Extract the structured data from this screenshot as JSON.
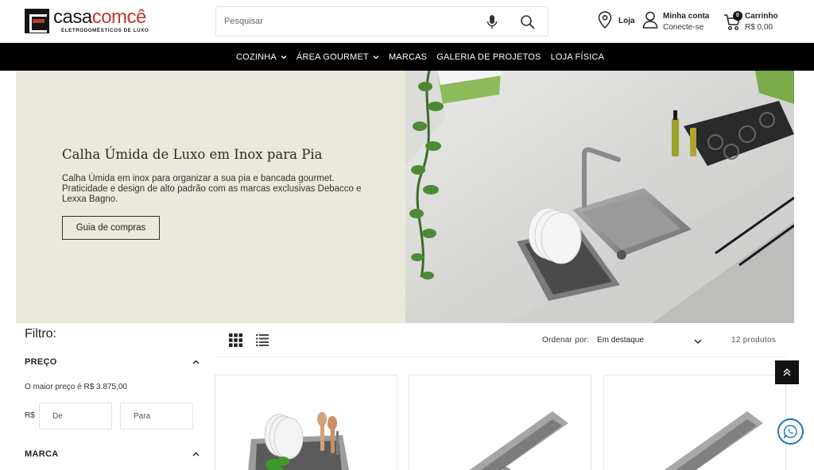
{
  "header": {
    "logo": {
      "brand_main": "casa",
      "brand_accent": "comcê",
      "tagline": "ELETRODOMÉSTICOS DE LUXO"
    },
    "search": {
      "placeholder": "Pesquisar",
      "value": ""
    },
    "store_link": {
      "label": "Loja",
      "icon": "map-pin-icon"
    },
    "account": {
      "title": "Minha conta",
      "subtitle": "Conecte-se",
      "icon": "user-icon"
    },
    "cart": {
      "title": "Carrinho",
      "total": "R$ 0,00",
      "count": "0",
      "icon": "cart-icon"
    }
  },
  "nav": {
    "items": [
      {
        "label": "COZINHA",
        "has_dropdown": true
      },
      {
        "label": "ÁREA GOURMET",
        "has_dropdown": true
      },
      {
        "label": "MARCAS",
        "has_dropdown": false
      },
      {
        "label": "GALERIA DE PROJETOS",
        "has_dropdown": false
      },
      {
        "label": "LOJA FÍSICA",
        "has_dropdown": false
      }
    ]
  },
  "hero": {
    "title": "Calha Úmida de Luxo em Inox para Pia",
    "description": "Calha Úmida em inox para organizar a sua pia e bancada gourmet. Praticidade e design de alto padrão com as marcas exclusivas Debacco e Lexxa Bagno.",
    "button": "Guia de compras"
  },
  "filters": {
    "title": "Filtro:",
    "price": {
      "label": "PREÇO",
      "max_note": "O maior preço é R$ 3.875,00",
      "currency": "R$",
      "from_placeholder": "De",
      "to_placeholder": "Para"
    },
    "brand": {
      "label": "MARCA"
    }
  },
  "toolbar": {
    "sort_label": "Ordenar por:",
    "sort_value": "Em destaque",
    "product_count": "12 produtos"
  },
  "colors": {
    "nav_bg": "#000000",
    "hero_bg": "#ebe8dc",
    "brand_accent": "#c0392b",
    "whatsapp_ring": "#1e73be"
  }
}
